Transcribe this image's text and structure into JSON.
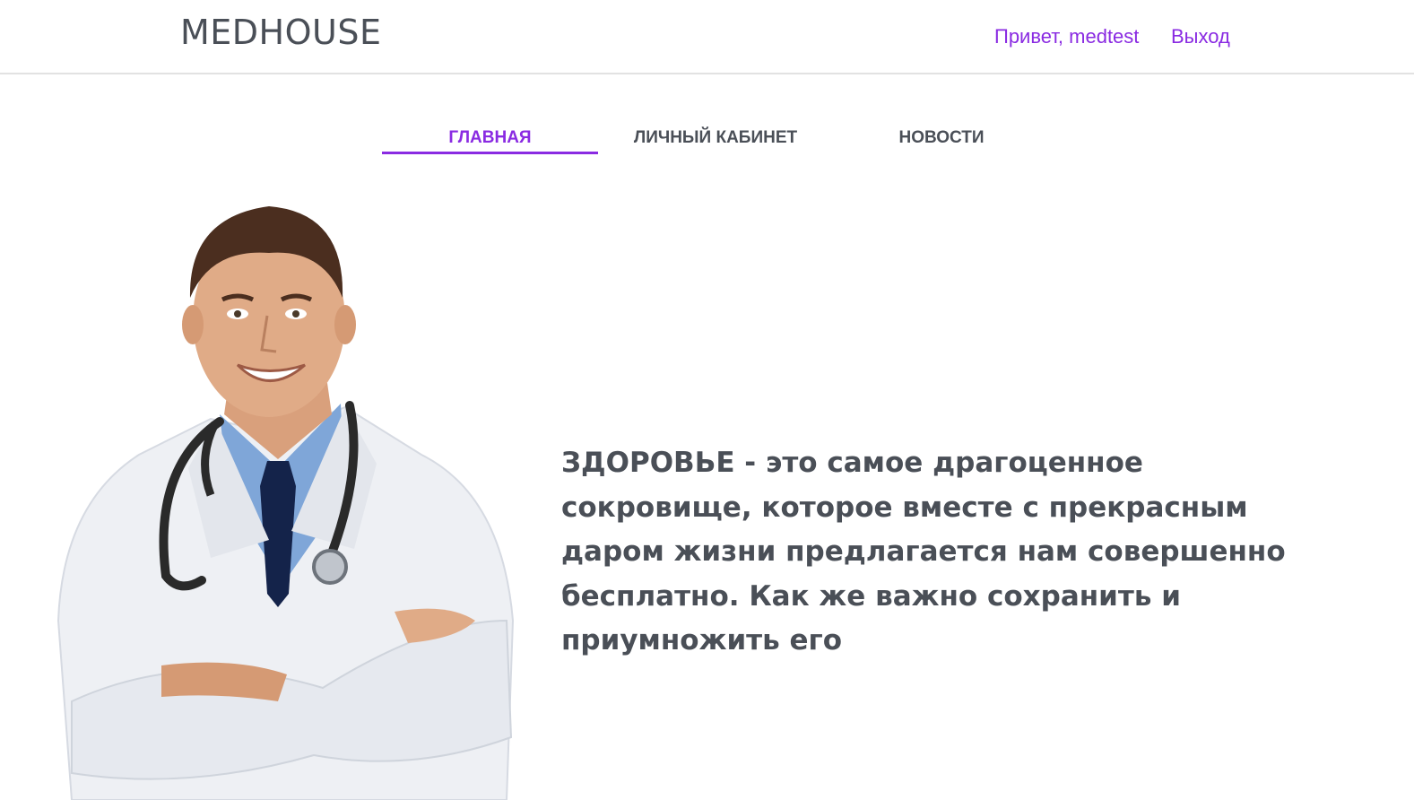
{
  "header": {
    "logo": "MEDHOUSE",
    "greeting": "Привет, medtest",
    "logout": "Выход"
  },
  "tabs": [
    {
      "label": "ГЛАВНАЯ",
      "active": true
    },
    {
      "label": "ЛИЧНЫЙ КАБИНЕТ",
      "active": false
    },
    {
      "label": "НОВОСТИ",
      "active": false
    }
  ],
  "hero": {
    "quote": "ЗДОРОВЬЕ - это самое драгоценное сокровище, которое вместе с прекрасным даром жизни предлагается нам совершенно бесплатно. Как же важно сохранить и приумножить его"
  },
  "colors": {
    "accent": "#8a2be2",
    "text": "#4a4f57"
  }
}
